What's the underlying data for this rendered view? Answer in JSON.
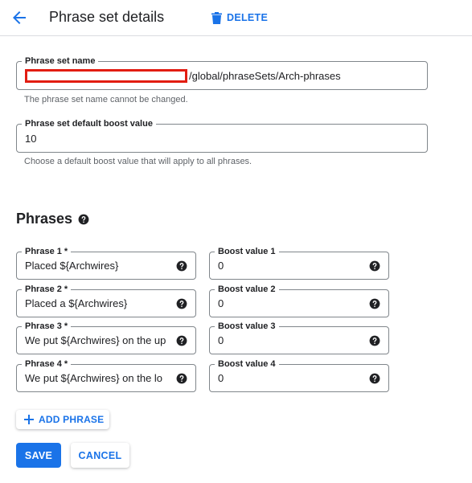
{
  "header": {
    "title": "Phrase set details",
    "delete_label": "DELETE"
  },
  "name_field": {
    "label": "Phrase set name",
    "value_suffix": "/global/phraseSets/Arch-phrases",
    "help": "The phrase set name cannot be changed."
  },
  "boost_field": {
    "label": "Phrase set default boost value",
    "value": "10",
    "help": "Choose a default boost value that will apply to all phrases."
  },
  "phrases_section": {
    "title": "Phrases"
  },
  "phrases": [
    {
      "label": "Phrase 1 *",
      "value": "Placed ${Archwires}",
      "boost_label": "Boost value 1",
      "boost_value": "0"
    },
    {
      "label": "Phrase 2 *",
      "value": "Placed a ${Archwires}",
      "boost_label": "Boost value 2",
      "boost_value": "0"
    },
    {
      "label": "Phrase 3 *",
      "value": "We put ${Archwires} on the up",
      "boost_label": "Boost value 3",
      "boost_value": "0"
    },
    {
      "label": "Phrase 4 *",
      "value": "We put ${Archwires} on the lo",
      "boost_label": "Boost value 4",
      "boost_value": "0"
    }
  ],
  "actions": {
    "add_phrase_label": "ADD PHRASE",
    "save_label": "SAVE",
    "cancel_label": "CANCEL"
  },
  "colors": {
    "accent": "#1a73e8",
    "redaction": "#e21d12"
  },
  "icons": [
    "arrow-back-icon",
    "trash-icon",
    "help-circle-icon",
    "plus-icon"
  ]
}
